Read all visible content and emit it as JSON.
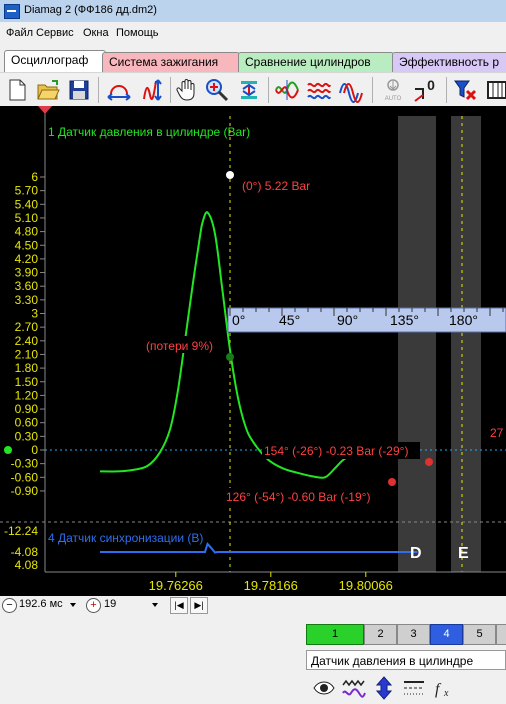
{
  "window": {
    "title": "Diamag 2 (ФФ186 дд.dm2)"
  },
  "menu": [
    "Файл",
    "Сервис",
    "Окна",
    "Помощь"
  ],
  "tabs": [
    {
      "label": "Осциллограф",
      "active": true,
      "color": "#ffffff"
    },
    {
      "label": "Система зажигания",
      "active": false,
      "color": "#f7b7bd"
    },
    {
      "label": "Сравнение цилиндров",
      "active": false,
      "color": "#b9ecc0"
    },
    {
      "label": "Эффективность р",
      "active": false,
      "color": "#d7c8f5"
    }
  ],
  "toolbar": {
    "buttons": [
      "new-file-icon",
      "open-folder-icon",
      "save-icon",
      "zoom-h-icon",
      "zoom-v-icon",
      "hand-icon",
      "magnifier-icon",
      "fit-icon",
      "waves-icon",
      "waves2-icon",
      "waves3-icon",
      "auto-icon",
      "trigger-zero-icon",
      "filter-icon",
      "panel-icon"
    ],
    "auto_label": "AUTO",
    "zero_label": "0"
  },
  "scope": {
    "channel1_label": "1 Датчик давления в цилиндре (Bar)",
    "channel4_label": "4 Датчик синхронизации (В)",
    "y1_ticks": [
      "6",
      "5.70",
      "5.40",
      "5.10",
      "4.80",
      "4.50",
      "4.20",
      "3.90",
      "3.60",
      "3.30",
      "3",
      "2.70",
      "2.40",
      "2.10",
      "1.80",
      "1.50",
      "1.20",
      "0.90",
      "0.60",
      "0.30",
      "0",
      "-0.30",
      "-0.60",
      "-0.90"
    ],
    "y4_ticks": [
      "-12.24",
      "-4.08",
      "4.08"
    ],
    "x_ticks": [
      "19.76266",
      "19.78166",
      "19.80066"
    ],
    "angle_ruler": [
      "0°",
      "45°",
      "90°",
      "135°",
      "180°"
    ],
    "annotations": {
      "peak": "(0°) 5.22 Bar",
      "loss": "(потери 9%)",
      "point154": "154° (-26°) -0.23 Bar (-29°)",
      "point126": "126° (-54°) -0.60 Bar (-19°)",
      "edge_label": "27"
    },
    "zone_d": "D",
    "zone_e": "E"
  },
  "chart_data": {
    "type": "line",
    "xlabel": "",
    "ylabel": "",
    "x_ticks": [
      "19.76266",
      "19.78166",
      "19.80066"
    ],
    "ylim": [
      -0.9,
      6
    ],
    "series": [
      {
        "name": "1 Датчик давления в цилиндре (Bar)",
        "color": "#22e622",
        "x": [
          19.7475,
          19.751,
          19.754,
          19.757,
          19.7595,
          19.7615,
          19.763,
          19.7645,
          19.766,
          19.7675,
          19.768,
          19.769,
          19.7705,
          19.772,
          19.7735,
          19.775,
          19.7765,
          19.778,
          19.781,
          19.784,
          19.787,
          19.79,
          19.7925,
          19.7945,
          19.796,
          19.798,
          19.799,
          19.8005,
          19.8015,
          19.8025,
          19.8045,
          19.806,
          19.8075,
          19.809,
          19.811
        ],
        "y": [
          -0.47,
          -0.47,
          -0.44,
          -0.35,
          -0.05,
          0.45,
          1.25,
          2.4,
          3.6,
          4.7,
          5.0,
          5.22,
          4.75,
          3.5,
          2.2,
          1.2,
          0.55,
          0.2,
          -0.2,
          -0.4,
          -0.5,
          -0.58,
          -0.6,
          -0.4,
          -0.23,
          -0.08,
          0.04,
          0.05,
          -0.1,
          0.03,
          0.12,
          0.05,
          0.12,
          0.06,
          0.1
        ]
      },
      {
        "name": "4 Датчик синхронизации (В)",
        "color": "#2f6ef0",
        "x": [
          19.7475,
          19.7685,
          19.769,
          19.7695,
          19.7705,
          19.771,
          19.811
        ],
        "y": [
          -4.08,
          -4.08,
          -2.0,
          -2.7,
          -4.2,
          -4.08,
          -4.08
        ]
      }
    ]
  },
  "status": {
    "time_scale": "192.6 мс",
    "channel_value": "19"
  },
  "bottom": {
    "channel_buttons": [
      "1",
      "2",
      "3",
      "4",
      "5"
    ],
    "channel_name": "Датчик давления в цилиндре"
  }
}
